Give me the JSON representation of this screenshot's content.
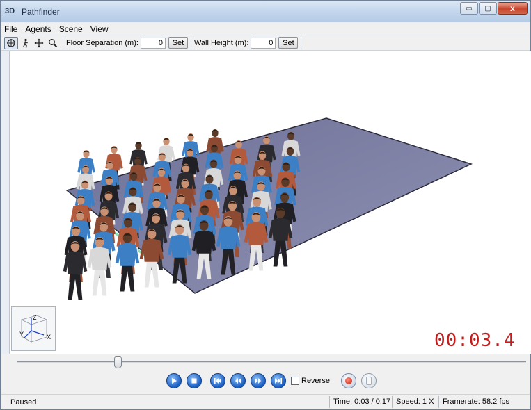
{
  "window": {
    "app_icon_text": "3D",
    "title": "Pathfinder",
    "minimize_glyph": "▭",
    "maximize_glyph": "▢",
    "close_glyph": "x"
  },
  "menu": [
    "File",
    "Agents",
    "Scene",
    "View"
  ],
  "toolbar": {
    "floor_sep_label": "Floor Separation (m):",
    "floor_sep_value": "0",
    "floor_set_label": "Set",
    "wall_height_label": "Wall Height (m):",
    "wall_height_value": "0",
    "wall_set_label": "Set"
  },
  "viewport": {
    "timer": "00:03.4",
    "axis_labels": {
      "z": "Z",
      "y": "Y",
      "x": "X"
    },
    "floor_color": "#7f82a6",
    "shirt_color": "#3d7fc4"
  },
  "playback": {
    "slider_progress": 0.2,
    "reverse_label": "Reverse",
    "reverse_checked": false
  },
  "status": {
    "state": "Paused",
    "time": "Time: 0:03 / 0:17",
    "speed": "Speed: 1 X",
    "framerate": "Framerate: 58.2 fps"
  }
}
